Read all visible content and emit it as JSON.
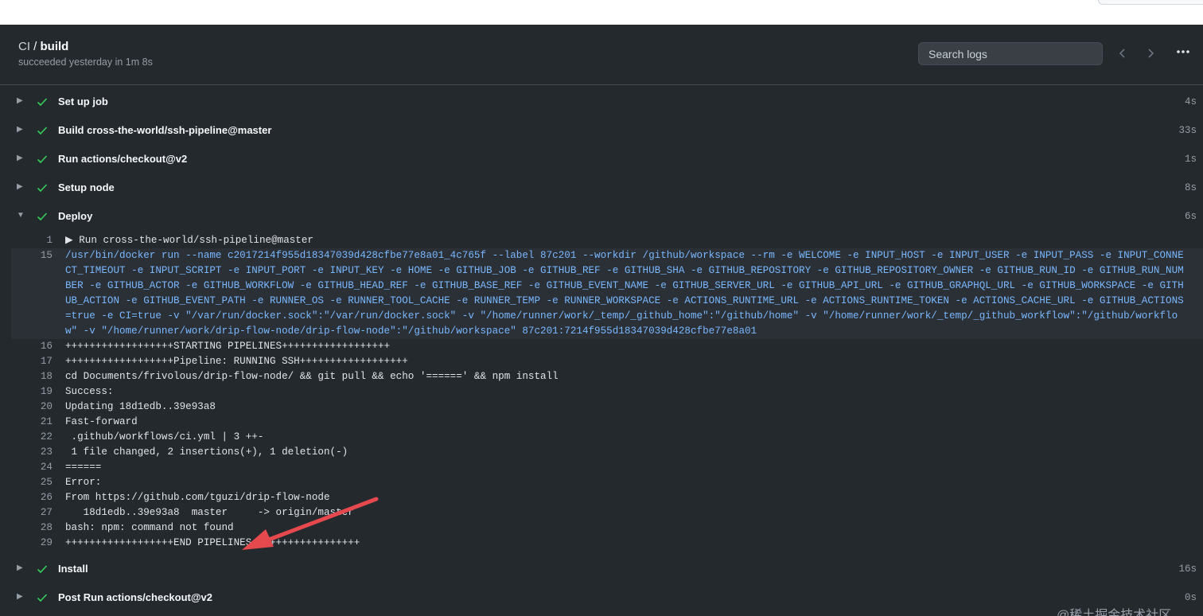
{
  "header": {
    "workflow": "CI",
    "separator": " / ",
    "job": "build",
    "status": "succeeded yesterday in 1m 8s",
    "search_placeholder": "Search logs",
    "prev_icon": "chevron-left-icon",
    "next_icon": "chevron-right-icon",
    "more_icon": "kebab-horizontal-icon"
  },
  "steps_top": [
    {
      "name": "Set up job",
      "duration": "4s",
      "expanded": false
    },
    {
      "name": "Build cross-the-world/ssh-pipeline@master",
      "duration": "33s",
      "expanded": false
    },
    {
      "name": "Run actions/checkout@v2",
      "duration": "1s",
      "expanded": false
    },
    {
      "name": "Setup node",
      "duration": "8s",
      "expanded": false
    },
    {
      "name": "Deploy",
      "duration": "6s",
      "expanded": true
    }
  ],
  "log": {
    "first": {
      "num": "1",
      "text": "▶ Run cross-the-world/ssh-pipeline@master"
    },
    "command": {
      "num": "15",
      "text": "/usr/bin/docker run --name c2017214f955d18347039d428cfbe77e8a01_4c765f --label 87c201 --workdir /github/workspace --rm -e WELCOME -e INPUT_HOST -e INPUT_USER -e INPUT_PASS -e INPUT_CONNECT_TIMEOUT -e INPUT_SCRIPT -e INPUT_PORT -e INPUT_KEY -e HOME -e GITHUB_JOB -e GITHUB_REF -e GITHUB_SHA -e GITHUB_REPOSITORY -e GITHUB_REPOSITORY_OWNER -e GITHUB_RUN_ID -e GITHUB_RUN_NUMBER -e GITHUB_ACTOR -e GITHUB_WORKFLOW -e GITHUB_HEAD_REF -e GITHUB_BASE_REF -e GITHUB_EVENT_NAME -e GITHUB_SERVER_URL -e GITHUB_API_URL -e GITHUB_GRAPHQL_URL -e GITHUB_WORKSPACE -e GITHUB_ACTION -e GITHUB_EVENT_PATH -e RUNNER_OS -e RUNNER_TOOL_CACHE -e RUNNER_TEMP -e RUNNER_WORKSPACE -e ACTIONS_RUNTIME_URL -e ACTIONS_RUNTIME_TOKEN -e ACTIONS_CACHE_URL -e GITHUB_ACTIONS=true -e CI=true -v \"/var/run/docker.sock\":\"/var/run/docker.sock\" -v \"/home/runner/work/_temp/_github_home\":\"/github/home\" -v \"/home/runner/work/_temp/_github_workflow\":\"/github/workflow\" -v \"/home/runner/work/drip-flow-node/drip-flow-node\":\"/github/workspace\" 87c201:7214f955d18347039d428cfbe77e8a01"
    },
    "lines": [
      {
        "num": "16",
        "text": "++++++++++++++++++STARTING PIPELINES++++++++++++++++++"
      },
      {
        "num": "17",
        "text": "++++++++++++++++++Pipeline: RUNNING SSH++++++++++++++++++"
      },
      {
        "num": "18",
        "text": "cd Documents/frivolous/drip-flow-node/ && git pull && echo '======' && npm install"
      },
      {
        "num": "19",
        "text": "Success:"
      },
      {
        "num": "20",
        "text": "Updating 18d1edb..39e93a8"
      },
      {
        "num": "21",
        "text": "Fast-forward"
      },
      {
        "num": "22",
        "text": " .github/workflows/ci.yml | 3 ++-"
      },
      {
        "num": "23",
        "text": " 1 file changed, 2 insertions(+), 1 deletion(-)"
      },
      {
        "num": "24",
        "text": "======"
      },
      {
        "num": "25",
        "text": "Error:"
      },
      {
        "num": "26",
        "text": "From https://github.com/tguzi/drip-flow-node"
      },
      {
        "num": "27",
        "text": "   18d1edb..39e93a8  master     -> origin/master"
      },
      {
        "num": "28",
        "text": "bash: npm: command not found"
      },
      {
        "num": "29",
        "text": "++++++++++++++++++END PIPELINES++++++++++++++++++"
      }
    ]
  },
  "steps_bottom": [
    {
      "name": "Install",
      "duration": "16s",
      "expanded": false
    },
    {
      "name": "Post Run actions/checkout@v2",
      "duration": "0s",
      "expanded": false
    }
  ],
  "watermark": "@稀土掘金技术社区",
  "colors": {
    "panel_bg": "#24292e",
    "success_green": "#34d058",
    "command_blue": "#79b8ff",
    "annotation_red": "#e5484d"
  }
}
